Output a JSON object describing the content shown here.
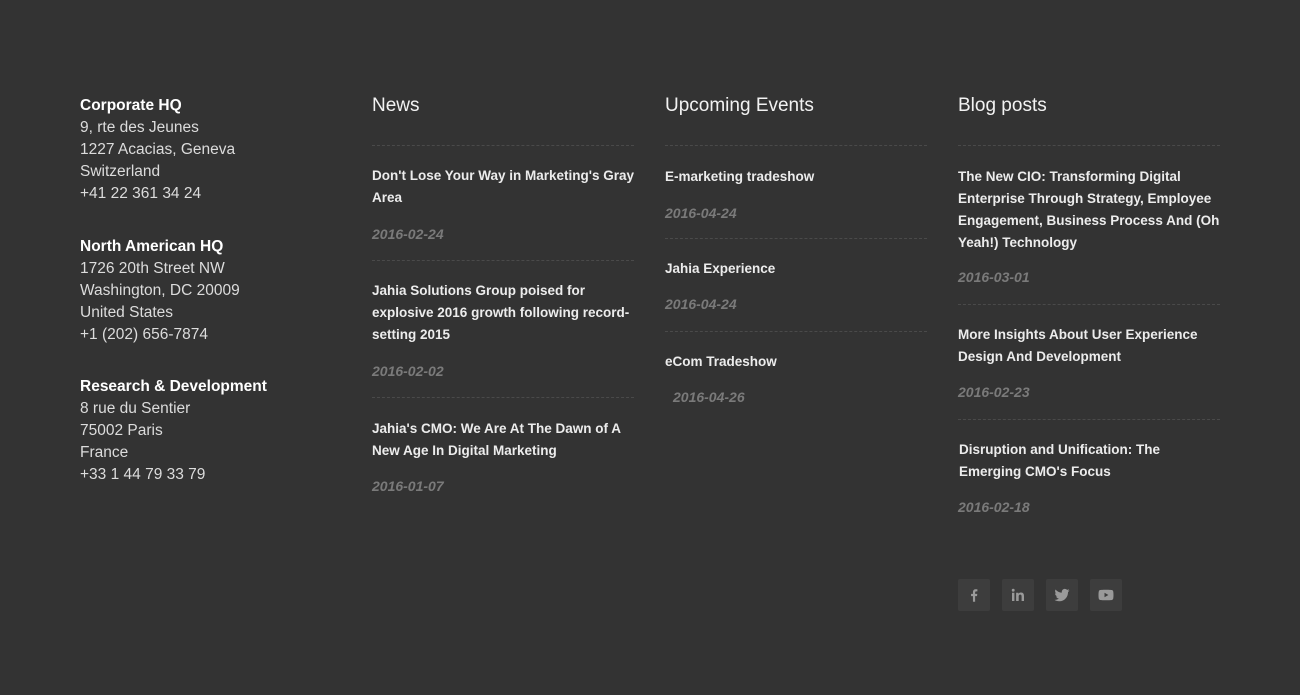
{
  "offices": [
    {
      "name": "Corporate HQ",
      "lines": [
        "9, rte des Jeunes",
        "1227 Acacias, Geneva",
        "Switzerland",
        "+41 22 361 34 24"
      ]
    },
    {
      "name": "North American HQ",
      "lines": [
        "1726 20th Street NW",
        "Washington, DC 20009",
        "United States",
        "+1 (202) 656-7874"
      ]
    },
    {
      "name": "Research & Development",
      "lines": [
        "8 rue du Sentier",
        "75002 Paris",
        "France",
        "+33 1 44 79 33 79"
      ]
    }
  ],
  "news": {
    "title": "News",
    "items": [
      {
        "title": "Don't Lose Your Way in Marketing's Gray Area",
        "date": "2016-02-24"
      },
      {
        "title": "Jahia Solutions Group poised for explosive 2016 growth following record-setting 2015",
        "date": "2016-02-02"
      },
      {
        "title": "Jahia's CMO: We Are At The Dawn of A New Age In Digital Marketing",
        "date": "2016-01-07"
      }
    ]
  },
  "events": {
    "title": "Upcoming Events",
    "items": [
      {
        "title": "E-marketing tradeshow",
        "date": "2016-04-24"
      },
      {
        "title": "Jahia Experience",
        "date": "2016-04-24"
      },
      {
        "title": "eCom Tradeshow",
        "date": "2016-04-26"
      }
    ]
  },
  "blog": {
    "title": "Blog posts",
    "items": [
      {
        "title": "The New CIO: Transforming Digital Enterprise Through Strategy, Employee Engagement, Business Process And (Oh Yeah!) Technology",
        "date": "2016-03-01"
      },
      {
        "title": "More Insights About User Experience Design And Development",
        "date": "2016-02-23"
      },
      {
        "title": "Disruption and Unification: The Emerging CMO's Focus",
        "date": "2016-02-18"
      }
    ]
  },
  "social": [
    {
      "icon": "facebook-icon"
    },
    {
      "icon": "linkedin-icon"
    },
    {
      "icon": "twitter-icon"
    },
    {
      "icon": "youtube-icon"
    }
  ]
}
